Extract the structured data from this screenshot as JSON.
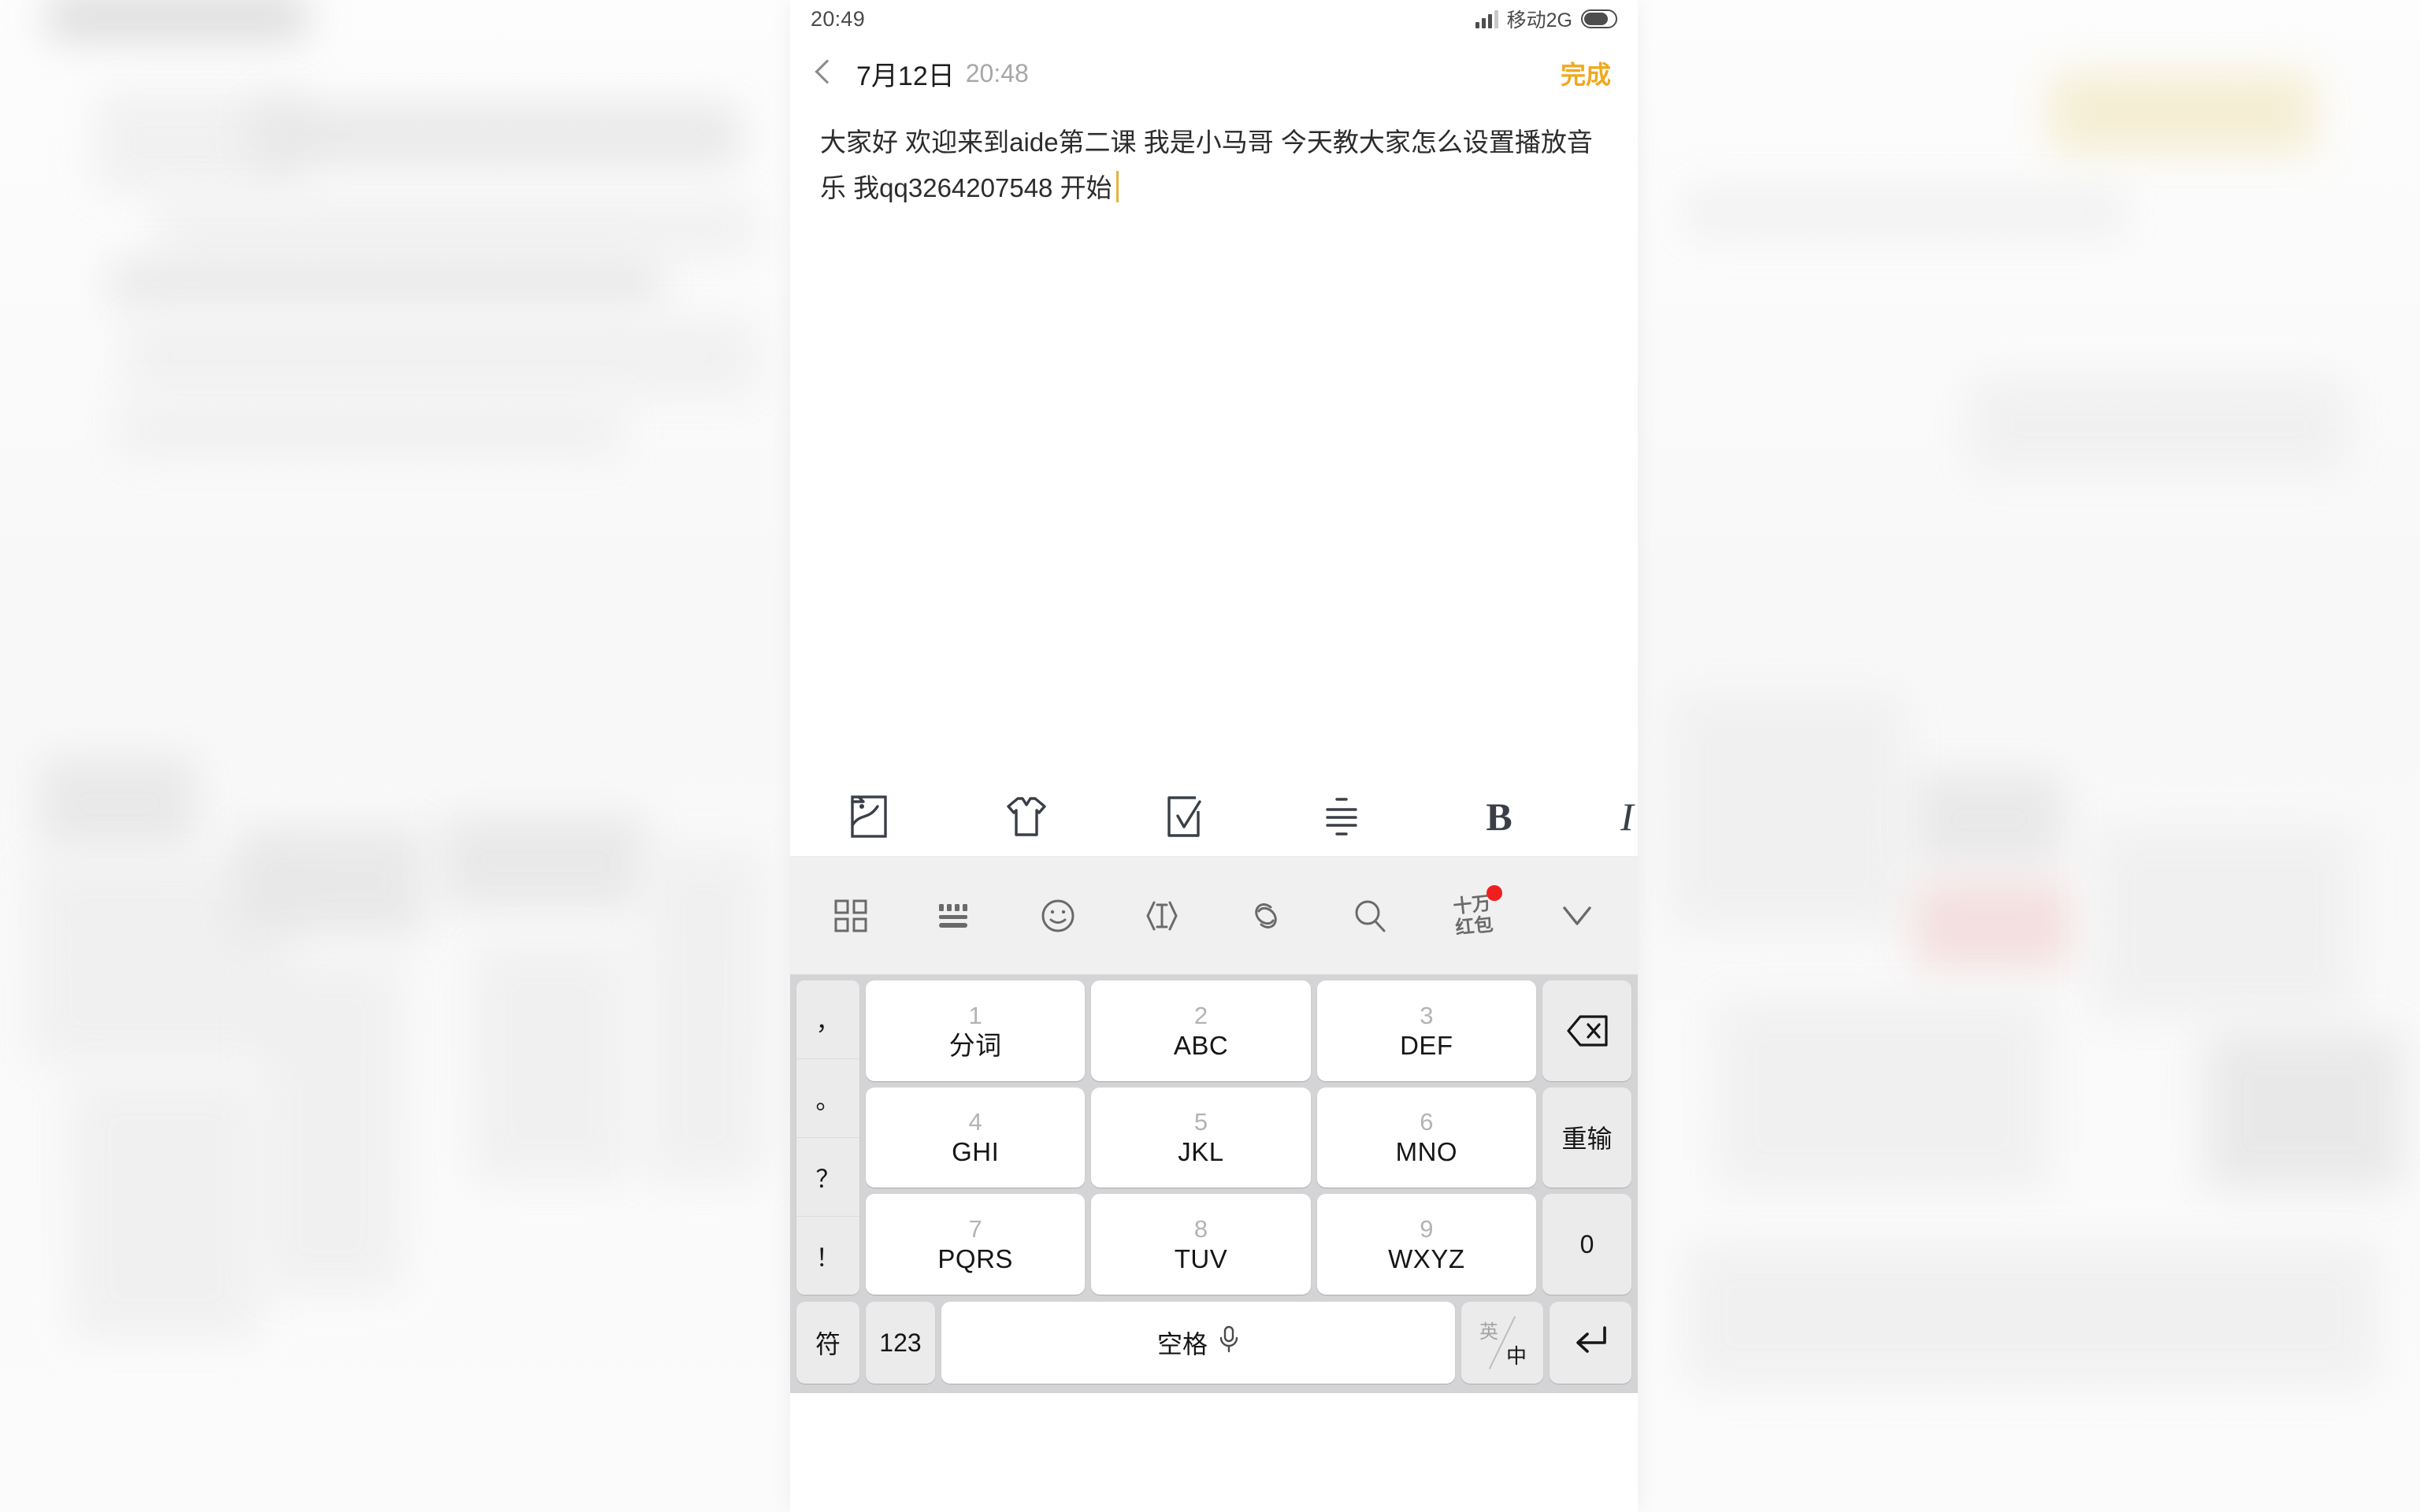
{
  "status_bar": {
    "time": "20:49",
    "carrier": "移动2G",
    "signal_icon": "signal-bars-icon",
    "battery_icon": "battery-icon"
  },
  "nav": {
    "back_icon": "back-chevron-icon",
    "title": "7月12日",
    "time": "20:48",
    "done_label": "完成",
    "done_color": "#f0a81e"
  },
  "editor": {
    "text": "大家好 欢迎来到aide第二课 我是小马哥 今天教大家怎么设置播放音乐 我qq3264207548 开始",
    "caret_color": "#e8b13c"
  },
  "format_toolbar": {
    "items": [
      {
        "name": "image-icon",
        "label": "图片"
      },
      {
        "name": "tshirt-icon",
        "label": "皮肤"
      },
      {
        "name": "checkbox-icon",
        "label": "待办"
      },
      {
        "name": "align-icon",
        "label": "对齐"
      },
      {
        "name": "bold-icon",
        "label": "B"
      },
      {
        "name": "italic-icon",
        "label": "I"
      }
    ]
  },
  "keyboard_toolbar": {
    "items": [
      {
        "name": "apps-grid-icon",
        "label": "应用"
      },
      {
        "name": "keyboard-icon",
        "label": "键盘"
      },
      {
        "name": "emoji-icon",
        "label": "表情"
      },
      {
        "name": "text-select-icon",
        "label": "选词"
      },
      {
        "name": "clip-icon",
        "label": "剪贴板"
      },
      {
        "name": "search-icon",
        "label": "搜索"
      }
    ],
    "redpacket": {
      "name": "red-packet-icon",
      "line1": "十万",
      "line2": "红包",
      "badge_color": "#f01f1f"
    },
    "collapse": {
      "name": "chevron-down-icon",
      "label": "收起"
    }
  },
  "keypad": {
    "punctuation": [
      {
        "label": "，",
        "name": "key-comma"
      },
      {
        "label": "。",
        "name": "key-period"
      },
      {
        "label": "？",
        "name": "key-question"
      },
      {
        "label": "！",
        "name": "key-exclaim"
      }
    ],
    "numbers": [
      {
        "digit": "1",
        "sub": "分词"
      },
      {
        "digit": "2",
        "sub": "ABC"
      },
      {
        "digit": "3",
        "sub": "DEF"
      },
      {
        "digit": "4",
        "sub": "GHI"
      },
      {
        "digit": "5",
        "sub": "JKL"
      },
      {
        "digit": "6",
        "sub": "MNO"
      },
      {
        "digit": "7",
        "sub": "PQRS"
      },
      {
        "digit": "8",
        "sub": "TUV"
      },
      {
        "digit": "9",
        "sub": "WXYZ"
      }
    ],
    "right_column": [
      {
        "label": "",
        "name": "backspace-key",
        "icon": "backspace-icon"
      },
      {
        "label": "重输",
        "name": "reinput-key",
        "icon": ""
      },
      {
        "label": "0",
        "name": "key-zero",
        "icon": ""
      }
    ],
    "bottom_row": {
      "symbol": "符",
      "numeric": "123",
      "space": "空格",
      "space_mic_icon": "microphone-icon",
      "lang_en": "英",
      "lang_zh": "中",
      "enter_icon": "enter-arrow-icon"
    }
  }
}
